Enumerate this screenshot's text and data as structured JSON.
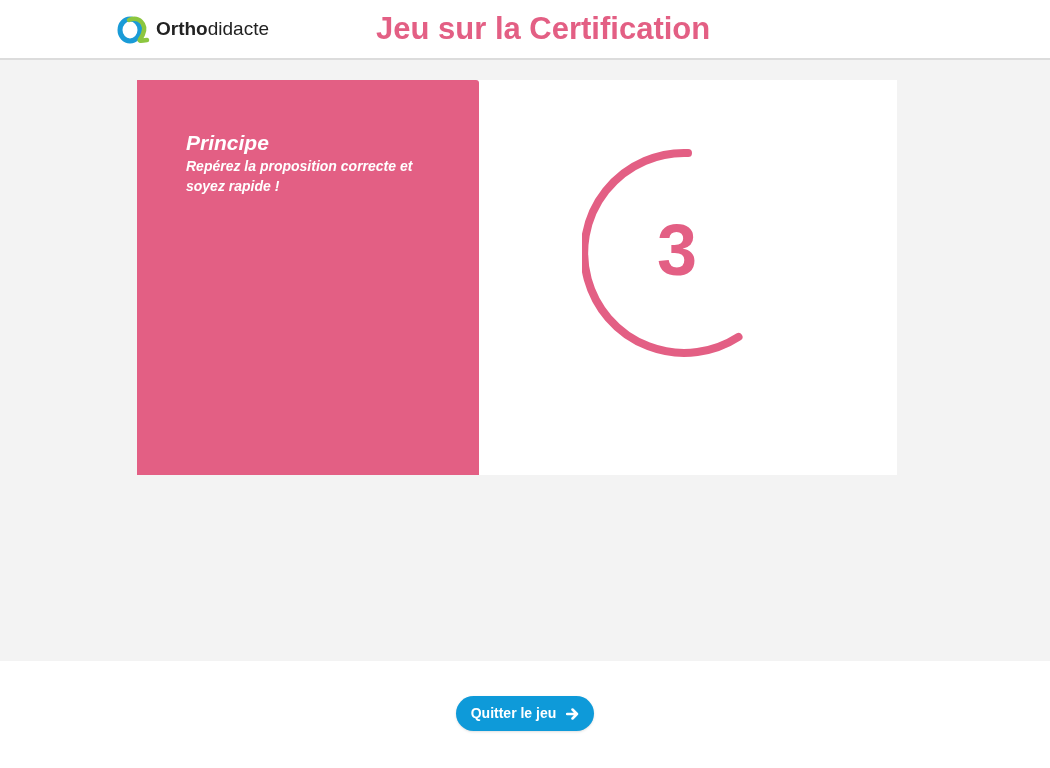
{
  "header": {
    "logo": "**Ortho**didacte",
    "title": "Jeu sur la Certification"
  },
  "principle": {
    "title": "Principe",
    "text": "Repérez la proposition correcte et soyez rapide !"
  },
  "countdown": {
    "number": "3"
  },
  "footer": {
    "button": "Quitter le jeu"
  }
}
